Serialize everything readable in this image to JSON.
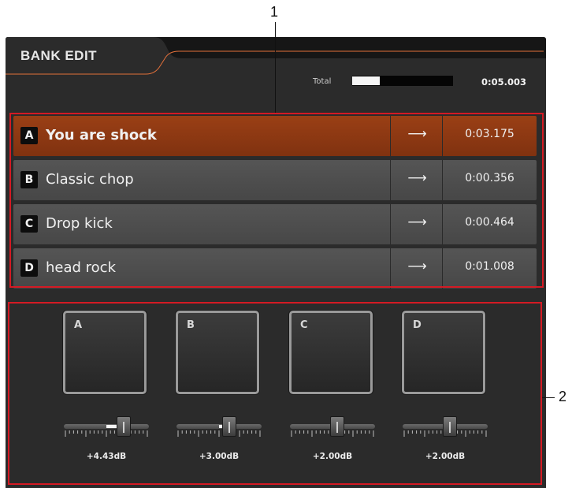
{
  "header": {
    "title": "BANK EDIT",
    "total_label": "Total",
    "total_time": "0:05.003",
    "total_progress": 0.27
  },
  "banks": [
    {
      "letter": "A",
      "name": "You are shock",
      "arrow": "⟶",
      "time": "0:03.175",
      "selected": true
    },
    {
      "letter": "B",
      "name": "Classic chop",
      "arrow": "⟶",
      "time": "0:00.356",
      "selected": false
    },
    {
      "letter": "C",
      "name": "Drop kick",
      "arrow": "⟶",
      "time": "0:00.464",
      "selected": false
    },
    {
      "letter": "D",
      "name": "head rock",
      "arrow": "⟶",
      "time": "0:01.008",
      "selected": false
    }
  ],
  "pads": [
    {
      "label": "A",
      "gain": "+4.43dB",
      "gain_level": 0.7
    },
    {
      "label": "B",
      "gain": "+3.00dB",
      "gain_level": 0.62
    },
    {
      "label": "C",
      "gain": "+2.00dB",
      "gain_level": 0.56
    },
    {
      "label": "D",
      "gain": "+2.00dB",
      "gain_level": 0.56
    }
  ],
  "callouts": {
    "one": "1",
    "two": "2"
  },
  "colors": {
    "accent": "#e2703a",
    "selected_row": "#8f3a12",
    "callout": "#d41a24"
  }
}
